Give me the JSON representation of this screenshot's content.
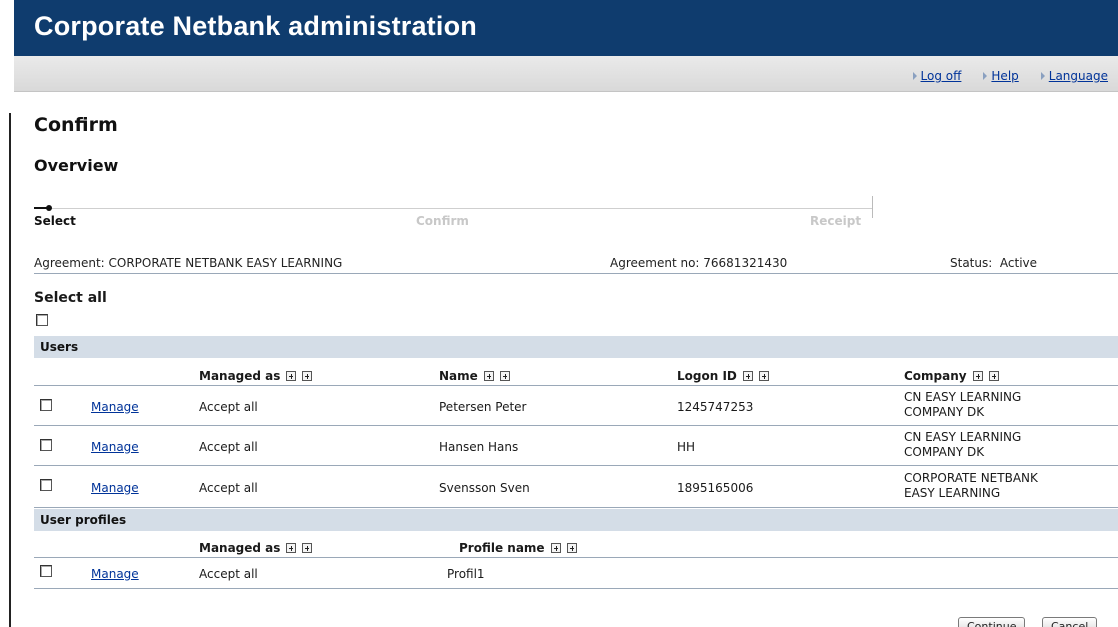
{
  "header": {
    "title": "Corporate Netbank administration"
  },
  "toplinks": {
    "logoff": "Log off",
    "help": "Help",
    "language": "Language"
  },
  "page": {
    "title": "Confirm",
    "subtitle": "Overview"
  },
  "steps": [
    "Select",
    "Confirm",
    "Receipt"
  ],
  "agreement": {
    "name": "Agreement: CORPORATE NETBANK EASY LEARNING",
    "number": "Agreement no: 76681321430",
    "status": "Status:  Active"
  },
  "select_all": "Select all",
  "users": {
    "section_title": "Users",
    "columns": [
      "Managed as",
      "Name",
      "Logon ID",
      "Company"
    ],
    "rows": [
      {
        "action": "Manage",
        "managed_as": "Accept all",
        "name": "Petersen Peter",
        "logon_id": "1245747253",
        "company_line1": "CN EASY LEARNING",
        "company_line2": "COMPANY DK"
      },
      {
        "action": "Manage",
        "managed_as": "Accept all",
        "name": "Hansen Hans",
        "logon_id": "HH",
        "company_line1": "CN EASY LEARNING",
        "company_line2": "COMPANY DK"
      },
      {
        "action": "Manage",
        "managed_as": "Accept all",
        "name": "Svensson Sven",
        "logon_id": "1895165006",
        "company_line1": "CORPORATE NETBANK",
        "company_line2": "EASY LEARNING"
      }
    ]
  },
  "profiles": {
    "section_title": "User profiles",
    "columns": [
      "Managed as",
      "Profile name"
    ],
    "rows": [
      {
        "action": "Manage",
        "managed_as": "Accept all",
        "profile_name": "Profil1"
      }
    ]
  },
  "buttons": {
    "continue": "Continue",
    "cancel": "Cancel"
  }
}
